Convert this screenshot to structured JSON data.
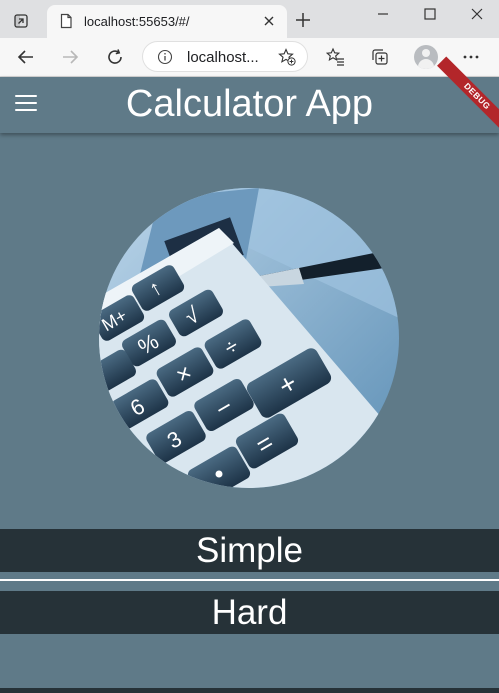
{
  "browser": {
    "tab_title": "localhost:55653/#/",
    "url": "localhost..."
  },
  "app": {
    "title": "Calculator App",
    "debug_banner": "DEBUG",
    "buttons": {
      "simple": "Simple",
      "hard": "Hard"
    }
  },
  "icons": {
    "menu": "menu-icon",
    "back": "back-arrow-icon",
    "forward": "forward-arrow-icon",
    "refresh": "refresh-icon",
    "info": "info-icon",
    "favorite": "add-favorite-icon",
    "favorites": "favorites-icon",
    "collections": "collections-icon",
    "profile": "profile-icon",
    "more": "more-icon"
  },
  "colors": {
    "app_background": "#5f7a88",
    "button_background": "#263238",
    "debug_banner": "#b3262a"
  }
}
